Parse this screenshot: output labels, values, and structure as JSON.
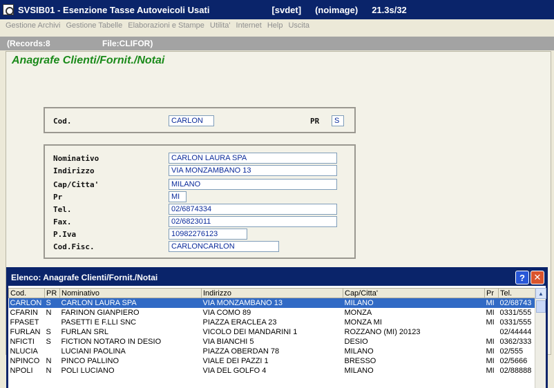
{
  "window": {
    "title": "SVSIB01 - Esenzione Tasse Autoveicoli Usati",
    "host": "[svdet]",
    "image": "(noimage)",
    "version": "21.3s/32"
  },
  "menu": [
    "Gestione Archivi",
    "Gestione Tabelle",
    "Elaborazioni e Stampe",
    "Utilita'",
    "Internet",
    "Help",
    "Uscita"
  ],
  "status": {
    "records": "(Records:8",
    "file": "File:CLIFOR)"
  },
  "form": {
    "title": "Anagrafe Clienti/Fornit./Notai",
    "cod_label": "Cod.",
    "cod_value": "CARLON",
    "pr_label": "PR",
    "pr_value": "S",
    "nominativo_label": "Nominativo",
    "nominativo_value": "CARLON LAURA SPA",
    "indirizzo_label": "Indirizzo",
    "indirizzo_value": "VIA MONZAMBANO 13",
    "cap_label": "Cap/Citta'",
    "cap_value": "MILANO",
    "prov_label": "Pr",
    "prov_value": "MI",
    "tel_label": "Tel.",
    "tel_value": "02/6874334",
    "fax_label": "Fax.",
    "fax_value": "02/6823011",
    "piva_label": "P.Iva",
    "piva_value": "10982276123",
    "codfisc_label": "Cod.Fisc.",
    "codfisc_value": "CARLONCARLON"
  },
  "list": {
    "title": "Elenco: Anagrafe Clienti/Fornit./Notai",
    "help_label": "?",
    "close_label": "✕",
    "columns": [
      "Cod.",
      "PR",
      "Nominativo",
      "Indirizzo",
      "Cap/Citta'",
      "Pr",
      "Tel."
    ],
    "rows": [
      [
        "CARLON",
        "S",
        "CARLON LAURA SPA",
        "VIA MONZAMBANO 13",
        "MILANO",
        "MI",
        "02/68743"
      ],
      [
        "CFARIN",
        "N",
        "FARINON GIANPIERO",
        "VIA COMO 89",
        "MONZA",
        "MI",
        "0331/555"
      ],
      [
        "FPASET",
        "",
        "PASETTI E F.LLI SNC",
        "PIAZZA ERACLEA 23",
        "MONZA    MI",
        "MI",
        "0331/555"
      ],
      [
        "FURLAN",
        "S",
        "FURLAN SRL",
        "VICOLO DEI MANDARINI 1",
        "ROZZANO (MI)   20123",
        "",
        "02/44444"
      ],
      [
        "NFICTI",
        "S",
        "FICTION NOTARO IN DESIO",
        "VIA BIANCHI 5",
        "DESIO",
        "MI",
        "0362/333"
      ],
      [
        "NLUCIA",
        "",
        "LUCIANI PAOLINA",
        "PIAZZA OBERDAN 78",
        "MILANO",
        "MI",
        "02/555"
      ],
      [
        "NPINCO",
        "N",
        "PINCO PALLINO",
        "VIALE DEI PAZZI 1",
        "BRESSO",
        "MI",
        "02/5666"
      ],
      [
        "NPOLI",
        "N",
        "POLI LUCIANO",
        "VIA DEL GOLFO 4",
        "MILANO",
        "MI",
        "02/88888"
      ]
    ]
  }
}
